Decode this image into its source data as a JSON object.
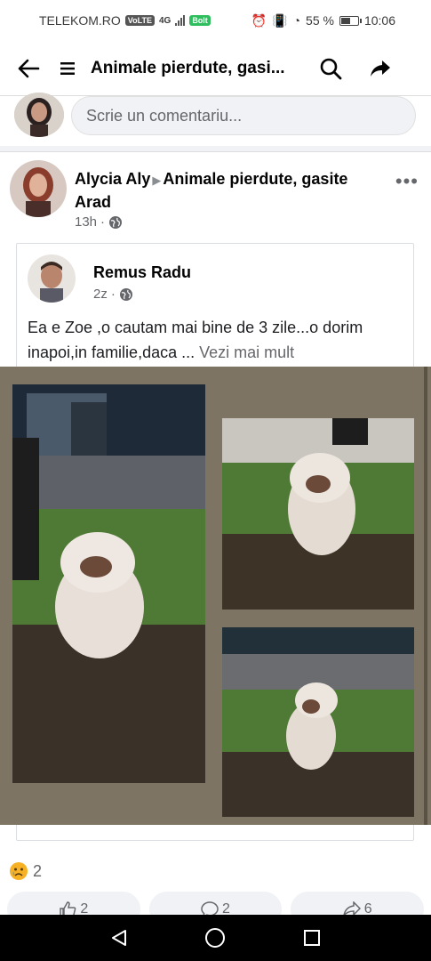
{
  "status": {
    "carrier": "TELEKOM.RO",
    "volte": "VoLTE",
    "network": "4G",
    "speed": "Bolt",
    "battery": "55 %",
    "battery_level": 0.55,
    "time": "10:06"
  },
  "header": {
    "title": "Animale pierdute, gasi..."
  },
  "comment": {
    "placeholder": "Scrie un comentariu..."
  },
  "post": {
    "author": "Alycia Aly",
    "group": "Animale pierdute, gasite Arad",
    "time": "13h"
  },
  "shared": {
    "author": "Remus Radu",
    "time": "2z",
    "text": "Ea e Zoe ,o cautam mai bine de 3 zile...o dorim inapoi,in familie,daca ...",
    "see_more": "Vezi mai mult"
  },
  "reactions": {
    "count": "2"
  },
  "actions": {
    "like_count": "2",
    "comment_count": "2",
    "share_count": "6"
  },
  "colors": {
    "photo_background": "#7d7463",
    "accent": "#1877f2"
  }
}
